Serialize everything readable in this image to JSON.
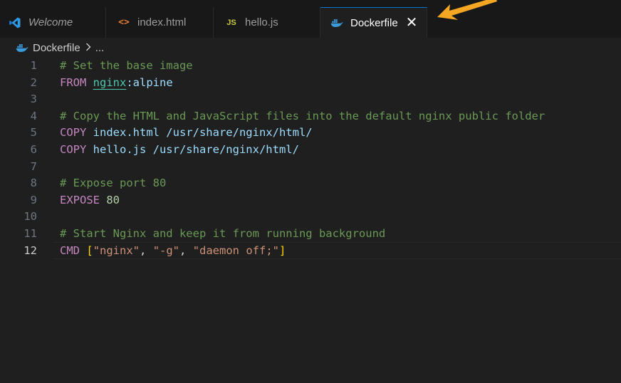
{
  "tabs": [
    {
      "label": "Welcome",
      "icon": "vscode-icon",
      "active": false
    },
    {
      "label": "index.html",
      "icon": "html-icon",
      "active": false
    },
    {
      "label": "hello.js",
      "icon": "js-icon",
      "active": false
    },
    {
      "label": "Dockerfile",
      "icon": "docker-icon",
      "active": true
    }
  ],
  "html_icon_text": "<>",
  "js_icon_text": "JS",
  "close_glyph": "✕",
  "breadcrumb": {
    "file": "Dockerfile",
    "more": "..."
  },
  "current_line": 12,
  "lines": [
    {
      "n": "1",
      "tokens": [
        {
          "t": "# Set the base image",
          "c": "comment"
        }
      ]
    },
    {
      "n": "2",
      "tokens": [
        {
          "t": "FROM",
          "c": "kw"
        },
        {
          "t": " ",
          "c": "text"
        },
        {
          "t": "nginx",
          "c": "img"
        },
        {
          "t": ":alpine",
          "c": "plain"
        }
      ]
    },
    {
      "n": "3",
      "tokens": []
    },
    {
      "n": "4",
      "tokens": [
        {
          "t": "# Copy the HTML and JavaScript files into the default nginx public folder",
          "c": "comment"
        }
      ]
    },
    {
      "n": "5",
      "tokens": [
        {
          "t": "COPY",
          "c": "kw"
        },
        {
          "t": " index.html /usr/share/nginx/html/",
          "c": "plain"
        }
      ]
    },
    {
      "n": "6",
      "tokens": [
        {
          "t": "COPY",
          "c": "kw"
        },
        {
          "t": " hello.js /usr/share/nginx/html/",
          "c": "plain"
        }
      ]
    },
    {
      "n": "7",
      "tokens": []
    },
    {
      "n": "8",
      "tokens": [
        {
          "t": "# Expose port 80",
          "c": "comment"
        }
      ]
    },
    {
      "n": "9",
      "tokens": [
        {
          "t": "EXPOSE",
          "c": "kw"
        },
        {
          "t": " ",
          "c": "text"
        },
        {
          "t": "80",
          "c": "num"
        }
      ]
    },
    {
      "n": "10",
      "tokens": []
    },
    {
      "n": "11",
      "tokens": [
        {
          "t": "# Start Nginx and keep it from running background",
          "c": "comment"
        }
      ]
    },
    {
      "n": "12",
      "tokens": [
        {
          "t": "CMD",
          "c": "kw"
        },
        {
          "t": " ",
          "c": "text"
        },
        {
          "t": "[",
          "c": "brk"
        },
        {
          "t": "\"nginx\"",
          "c": "str"
        },
        {
          "t": ", ",
          "c": "text"
        },
        {
          "t": "\"-g\"",
          "c": "str"
        },
        {
          "t": ", ",
          "c": "text"
        },
        {
          "t": "\"daemon off;\"",
          "c": "str"
        },
        {
          "t": "]",
          "c": "brk"
        }
      ]
    }
  ],
  "colors": {
    "accent": "#0078d4",
    "arrow": "#f5a623"
  }
}
